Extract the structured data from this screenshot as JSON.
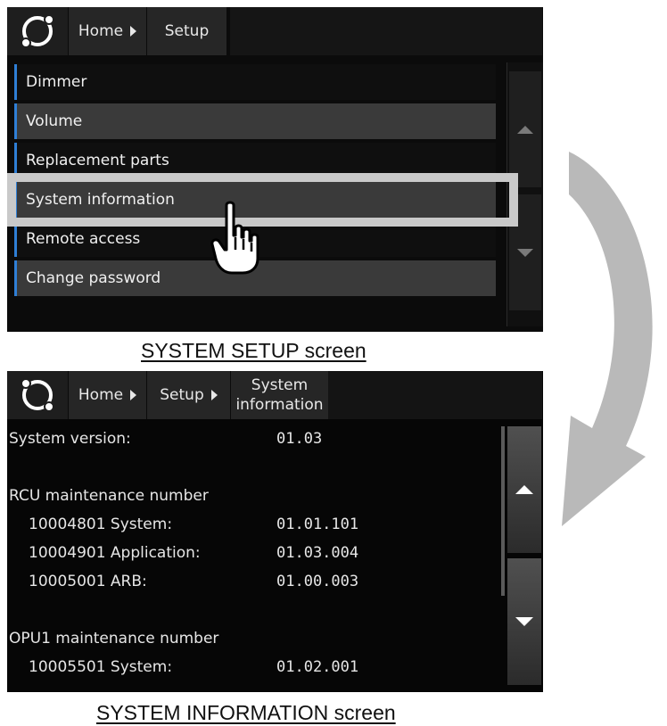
{
  "setup_screen": {
    "breadcrumb": {
      "home": "Home",
      "current": "Setup"
    },
    "menu_items": [
      {
        "label": "Dimmer"
      },
      {
        "label": "Volume"
      },
      {
        "label": "Replacement parts"
      },
      {
        "label": "System information"
      },
      {
        "label": "Remote access"
      },
      {
        "label": "Change password"
      }
    ],
    "caption": "SYSTEM SETUP screen"
  },
  "info_screen": {
    "breadcrumb": {
      "home": "Home",
      "setup": "Setup",
      "current_line1": "System",
      "current_line2": "information"
    },
    "system_version": {
      "label": "System version:",
      "value": "01.03"
    },
    "rcu": {
      "title": "RCU maintenance number",
      "rows": [
        {
          "label": "10004801 System:",
          "value": "01.01.101"
        },
        {
          "label": "10004901 Application:",
          "value": "01.03.004"
        },
        {
          "label": "10005001 ARB:",
          "value": "01.00.003"
        }
      ]
    },
    "opu1": {
      "title": "OPU1 maintenance number",
      "rows": [
        {
          "label": "10005501 System:",
          "value": "01.02.001"
        }
      ]
    },
    "caption": "SYSTEM INFORMATION screen"
  },
  "colors": {
    "accent": "#2f7fd6",
    "highlight": "#c9c9c9",
    "arrow": "#b9b9b9"
  }
}
